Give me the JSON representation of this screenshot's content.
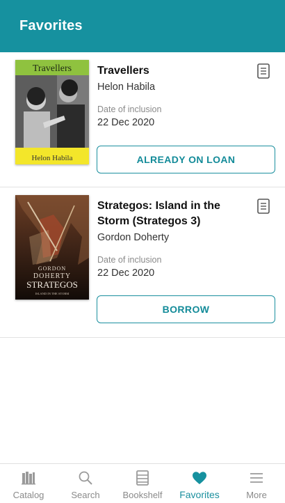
{
  "header": {
    "title": "Favorites"
  },
  "favorites": [
    {
      "title": "Travellers",
      "author": "Helon Habila",
      "date_label": "Date of inclusion",
      "date": "22 Dec 2020",
      "action": "ALREADY ON LOAN",
      "cover": {
        "top_text": "Travellers",
        "bottom_text": "Helon Habila",
        "top_color": "#8fc23f",
        "bottom_color": "#f3e62a"
      }
    },
    {
      "title": "Strategos: Island in the Storm (Strategos 3)",
      "author": "Gordon Doherty",
      "date_label": "Date of inclusion",
      "date": "22 Dec 2020",
      "action": "BORROW",
      "cover": {
        "line1": "GORDON",
        "line2": "DOHERTY",
        "line3": "STRATEGOS",
        "line4": "ISLAND IN THE STORM"
      }
    }
  ],
  "bottom_nav": [
    {
      "label": "Catalog",
      "icon": "catalog-icon"
    },
    {
      "label": "Search",
      "icon": "search-icon"
    },
    {
      "label": "Bookshelf",
      "icon": "bookshelf-icon"
    },
    {
      "label": "Favorites",
      "icon": "heart-icon",
      "active": true
    },
    {
      "label": "More",
      "icon": "menu-icon"
    }
  ],
  "colors": {
    "accent": "#16919f",
    "button_text": "#138b99",
    "muted": "#8a8a8a"
  }
}
